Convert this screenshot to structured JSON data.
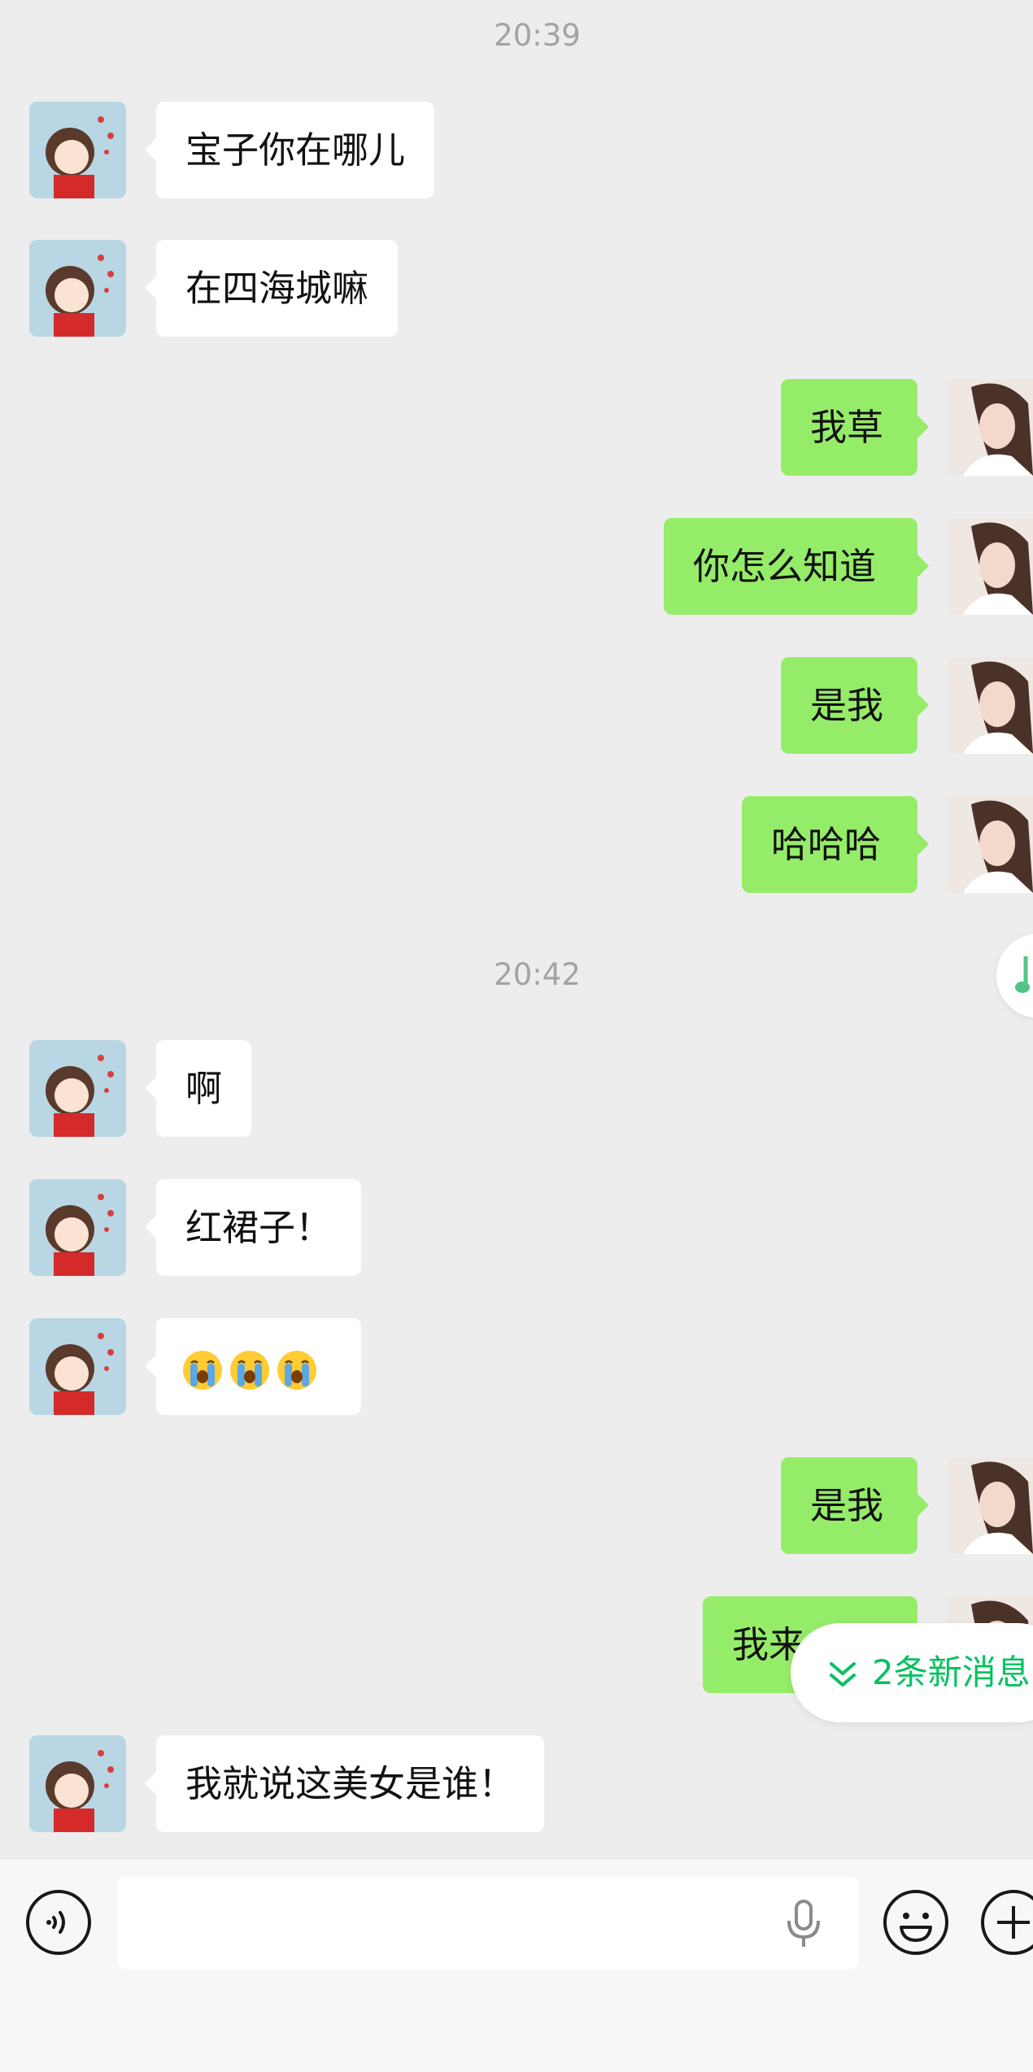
{
  "timestamps": [
    "20:39",
    "20:42"
  ],
  "messages": [
    {
      "side": "left",
      "text": "宝子你在哪儿"
    },
    {
      "side": "left",
      "text": "在四海城嘛"
    },
    {
      "side": "right",
      "text": "我草"
    },
    {
      "side": "right",
      "text": "你怎么知道"
    },
    {
      "side": "right",
      "text": "是我"
    },
    {
      "side": "right",
      "text": "哈哈哈"
    },
    {
      "side": "left",
      "text": "啊"
    },
    {
      "side": "left",
      "text": "红裙子！"
    },
    {
      "side": "left",
      "emoji": "loudly-crying-face",
      "emoji_count": 3
    },
    {
      "side": "right",
      "text": "是我"
    },
    {
      "side": "right",
      "text": "我来"
    },
    {
      "side": "left",
      "text": "我就说这美女是谁！"
    }
  ],
  "new_messages_pill": {
    "label": "2条新消息",
    "icon": "double-chevron-down-icon"
  },
  "input_bar": {
    "input_value": "",
    "icons": [
      "voice-mode-icon",
      "microphone-icon",
      "emoji-icon",
      "plus-icon"
    ]
  },
  "colors": {
    "background": "#ededed",
    "sent_bubble": "#95ec69",
    "received_bubble": "#ffffff",
    "accent": "#07c160",
    "timestamp": "#a3a3a3"
  }
}
